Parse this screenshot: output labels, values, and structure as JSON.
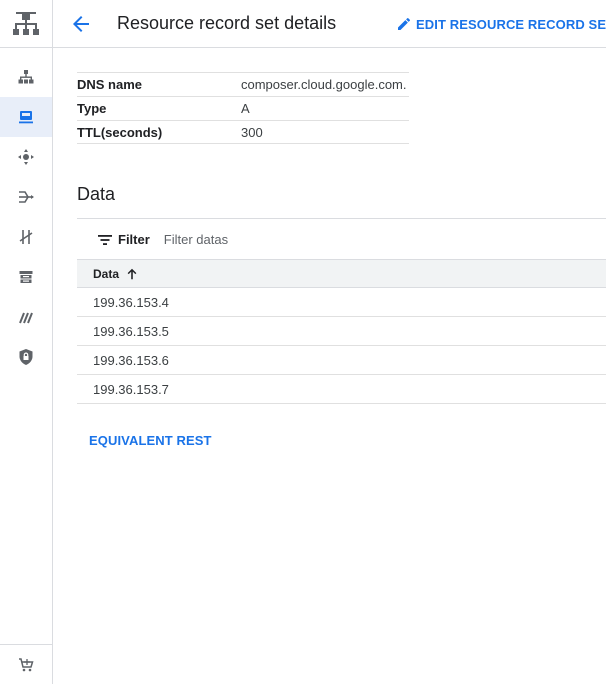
{
  "header": {
    "title": "Resource record set details",
    "edit_label": "EDIT RESOURCE RECORD SET"
  },
  "details": [
    {
      "key": "DNS name",
      "value": "composer.cloud.google.com."
    },
    {
      "key": "Type",
      "value": "A"
    },
    {
      "key": "TTL(seconds)",
      "value": "300"
    }
  ],
  "data_section": {
    "title": "Data",
    "filter_label": "Filter",
    "filter_placeholder": "Filter datas",
    "column_header": "Data",
    "rows": [
      "199.36.153.4",
      "199.36.153.5",
      "199.36.153.6",
      "199.36.153.7"
    ]
  },
  "rest_link": "EQUIVALENT REST",
  "sidebar": {
    "icons": [
      "network-topology-icon",
      "vpc-network-icon",
      "dns-server-icon",
      "load-balancing-icon",
      "hybrid-connectivity-icon",
      "network-services-icon",
      "cloud-storage-icon",
      "network-intelligence-icon",
      "network-security-icon",
      "marketplace-icon"
    ],
    "active_index": 1
  },
  "colors": {
    "accent": "#1a73e8",
    "active_bg": "#e8eef9",
    "icon": "#5f6368"
  }
}
